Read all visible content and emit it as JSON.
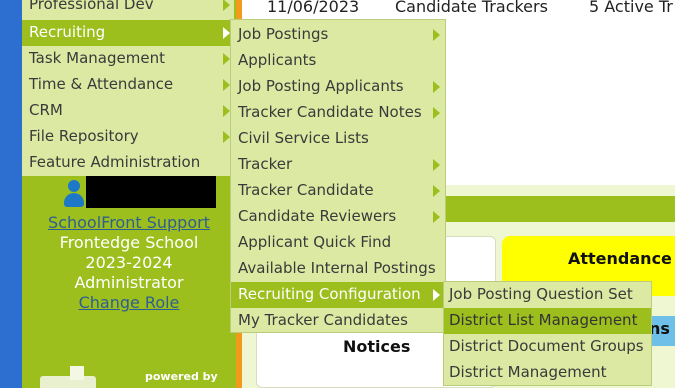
{
  "colors": {
    "sidebar_green": "#9cbf1e",
    "menu_bg": "#dbe9a3",
    "accent_orange": "#f39a1b",
    "desktop_blue": "#2c6fd1",
    "attendance_yellow": "#ffff00"
  },
  "table_row": {
    "date": "11/06/2023",
    "name": "Candidate Trackers",
    "status": "5 Active Tr"
  },
  "main_menu": {
    "items": [
      {
        "label": "Professional Dev",
        "has_submenu": true
      },
      {
        "label": "Recruiting",
        "has_submenu": true,
        "active": true
      },
      {
        "label": "Task Management",
        "has_submenu": true
      },
      {
        "label": "Time & Attendance",
        "has_submenu": true
      },
      {
        "label": "CRM",
        "has_submenu": true
      },
      {
        "label": "File Repository",
        "has_submenu": true
      },
      {
        "label": "Feature Administration",
        "has_submenu": false
      }
    ]
  },
  "recruiting_menu": {
    "items": [
      {
        "label": "Job Postings",
        "has_submenu": true
      },
      {
        "label": "Applicants",
        "has_submenu": false
      },
      {
        "label": "Job Posting Applicants",
        "has_submenu": true
      },
      {
        "label": "Tracker Candidate Notes",
        "has_submenu": true
      },
      {
        "label": "Civil Service Lists",
        "has_submenu": false
      },
      {
        "label": "Tracker",
        "has_submenu": true
      },
      {
        "label": "Tracker Candidate",
        "has_submenu": true
      },
      {
        "label": "Candidate Reviewers",
        "has_submenu": true
      },
      {
        "label": "Applicant Quick Find",
        "has_submenu": false
      },
      {
        "label": "Available Internal Postings",
        "has_submenu": false
      },
      {
        "label": "Recruiting Configuration",
        "has_submenu": true,
        "active": true
      },
      {
        "label": "My Tracker Candidates",
        "has_submenu": false
      }
    ]
  },
  "config_menu": {
    "items": [
      {
        "label": "Job Posting Question Set"
      },
      {
        "label": "District List Management",
        "hover": true
      },
      {
        "label": "District Document Groups"
      },
      {
        "label": "District Management"
      }
    ]
  },
  "sidebar_info": {
    "support_link": "SchoolFront Support",
    "school": "Frontedge School",
    "year": "2023-2024",
    "role": "Administrator",
    "change_role": "Change Role",
    "powered_by": "powered by"
  },
  "cards": {
    "attendance": "Attendance",
    "notices": "Notices",
    "partial_right": "ns"
  }
}
